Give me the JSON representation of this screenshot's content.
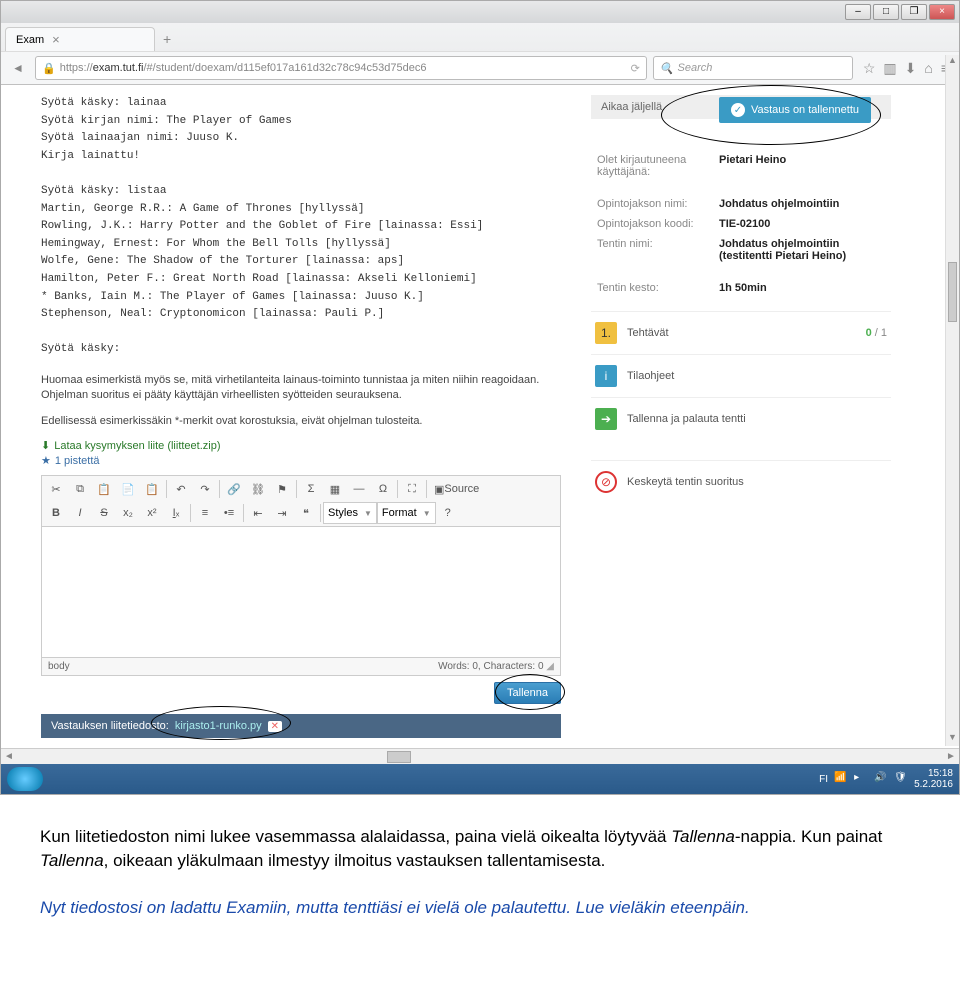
{
  "window": {
    "tab_title": "Exam",
    "url_prefix": "https://",
    "url_domain": "exam.tut.fi",
    "url_path": "/#/student/doexam/d115ef017a161d32c78c94c53d75dec6",
    "search_placeholder": "Search"
  },
  "console_text": "Syötä käsky: lainaa\nSyötä kirjan nimi: The Player of Games\nSyötä lainaajan nimi: Juuso K.\nKirja lainattu!\n\nSyötä käsky: listaa\nMartin, George R.R.: A Game of Thrones [hyllyssä]\nRowling, J.K.: Harry Potter and the Goblet of Fire [lainassa: Essi]\nHemingway, Ernest: For Whom the Bell Tolls [hyllyssä]\nWolfe, Gene: The Shadow of the Torturer [lainassa: aps]\nHamilton, Peter F.: Great North Road [lainassa: Akseli Kelloniemi]\n* Banks, Iain M.: The Player of Games [lainassa: Juuso K.]\nStephenson, Neal: Cryptonomicon [lainassa: Pauli P.]\n\nSyötä käsky:",
  "paragraph1": "Huomaa esimerkistä myös se, mitä virhetilanteita lainaus-toiminto tunnistaa ja miten niihin reagoidaan. Ohjelman suoritus ei pääty käyttäjän virheellisten syötteiden seurauksena.",
  "paragraph2": "Edellisessä esimerkissäkin *-merkit ovat korostuksia, eivät ohjelman tulosteita.",
  "attach": {
    "label": "Lataa kysymyksen liite (liitteet.zip)"
  },
  "points": {
    "label": "1 pistettä"
  },
  "toolbar": {
    "source": "Source",
    "styles": "Styles",
    "format": "Format"
  },
  "status": {
    "body": "body",
    "words": "Words: 0, Characters: 0"
  },
  "save": {
    "label": "Tallenna"
  },
  "attachment": {
    "label": "Vastauksen liitetiedosto:",
    "filename": "kirjasto1-runko.py"
  },
  "toast": {
    "label": "Vastaus on tallennettu"
  },
  "sidebar": {
    "time_left_label": "Aikaa jäljellä",
    "time_left_value": "",
    "rows": [
      {
        "label": "Olet kirjautuneena käyttäjänä:",
        "value": "Pietari Heino"
      },
      {
        "label": "Opintojakson nimi:",
        "value": "Johdatus ohjelmointiin"
      },
      {
        "label": "Opintojakson koodi:",
        "value": "TIE-02100"
      },
      {
        "label": "Tentin nimi:",
        "value": "Johdatus ohjelmointiin (testitentti Pietari Heino)"
      },
      {
        "label": "Tentin kesto:",
        "value": "1h 50min"
      }
    ],
    "actions": {
      "questions_num": "1.",
      "questions": "Tehtävät",
      "progress_done": "0",
      "progress_total": "1",
      "instructions": "Tilaohjeet",
      "submit": "Tallenna ja palauta tentti",
      "abort": "Keskeytä tentin suoritus"
    }
  },
  "taskbar": {
    "lang": "FI",
    "time": "15:18",
    "date": "5.2.2016"
  },
  "doc": {
    "p1a": "Kun liitetiedoston nimi lukee vasemmassa alalaidassa, paina vielä oikealta löytyvää ",
    "p1b": "Tallenna",
    "p1c": "-nappia. Kun painat ",
    "p1d": "Tallenna",
    "p1e": ", oikeaan yläkulmaan ilmestyy ilmoitus vastauksen tallentamisesta.",
    "p2": "Nyt tiedostosi on ladattu Examiin, mutta tenttiäsi ei vielä ole palautettu. Lue vieläkin eteenpäin."
  }
}
